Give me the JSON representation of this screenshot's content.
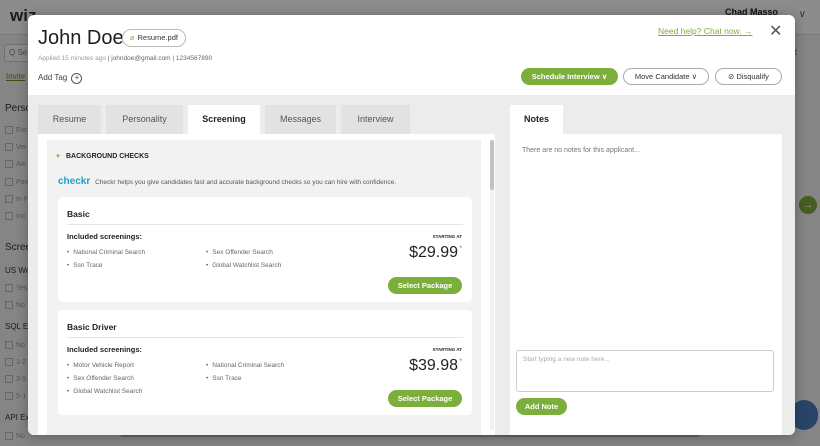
{
  "background": {
    "logo": "wiz",
    "user_name": "Chad Masso",
    "search_placeholder": "Q Se",
    "invite_label": "Invite",
    "sidebar": [
      {
        "title": "Perso",
        "items": [
          "Exc",
          "Ver",
          "Aw",
          "Pos",
          "In F",
          "Inc"
        ]
      },
      {
        "title": "Scree",
        "items": []
      },
      {
        "title": "US We",
        "items": [
          "Yes",
          "No"
        ]
      },
      {
        "title": "SQL Ex",
        "items": [
          "No",
          "1-2",
          "3-5",
          "5-1"
        ]
      },
      {
        "title": "API Ex",
        "items": [
          "No"
        ]
      }
    ]
  },
  "candidate": {
    "name": "John Doe",
    "resume_file": "Resume.pdf",
    "applied": "Applied 15 minutes ago",
    "email": "johndoe@gmail.com",
    "phone": "1234567890",
    "add_tag": "Add Tag"
  },
  "header": {
    "help_link": "Need help? Chat now. →",
    "schedule_label": "Schedule Interview ∨",
    "move_label": "Move Candidate ∨",
    "disqualify_label": "⊘ Disqualify"
  },
  "tabs": [
    {
      "label": "Resume",
      "active": false
    },
    {
      "label": "Personality",
      "active": false
    },
    {
      "label": "Screening",
      "active": true
    },
    {
      "label": "Messages",
      "active": false
    },
    {
      "label": "Interview",
      "active": false
    }
  ],
  "screening": {
    "section_title": "BACKGROUND CHECKS",
    "provider_logo": "checkr",
    "provider_text": "Checkr helps you give candidates fast and accurate background checks so you can hire with confidence.",
    "packages": [
      {
        "name": "Basic",
        "included_label": "Included screenings:",
        "starting_label": "STARTING AT",
        "col1": [
          "National Criminal Search",
          "Ssn Trace"
        ],
        "col2": [
          "Sex Offender Search",
          "Global Watchlist Search"
        ],
        "price": "$29.99",
        "price_note": "*",
        "button": "Select Package"
      },
      {
        "name": "Basic Driver",
        "included_label": "Included screenings:",
        "starting_label": "STARTING AT",
        "col1": [
          "Motor Vehicle Report",
          "Sex Offender Search",
          "Global Watchlist Search"
        ],
        "col2": [
          "National Criminal Search",
          "Ssn Trace"
        ],
        "price": "$39.98",
        "price_note": "*",
        "button": "Select Package"
      }
    ]
  },
  "notes": {
    "tab_label": "Notes",
    "empty_text": "There are no notes for this applicant...",
    "input_placeholder": "Start typing a new note here...",
    "add_button": "Add Note"
  },
  "colors": {
    "accent_green": "#7cae3c",
    "checkr_blue": "#1ea3c9"
  }
}
